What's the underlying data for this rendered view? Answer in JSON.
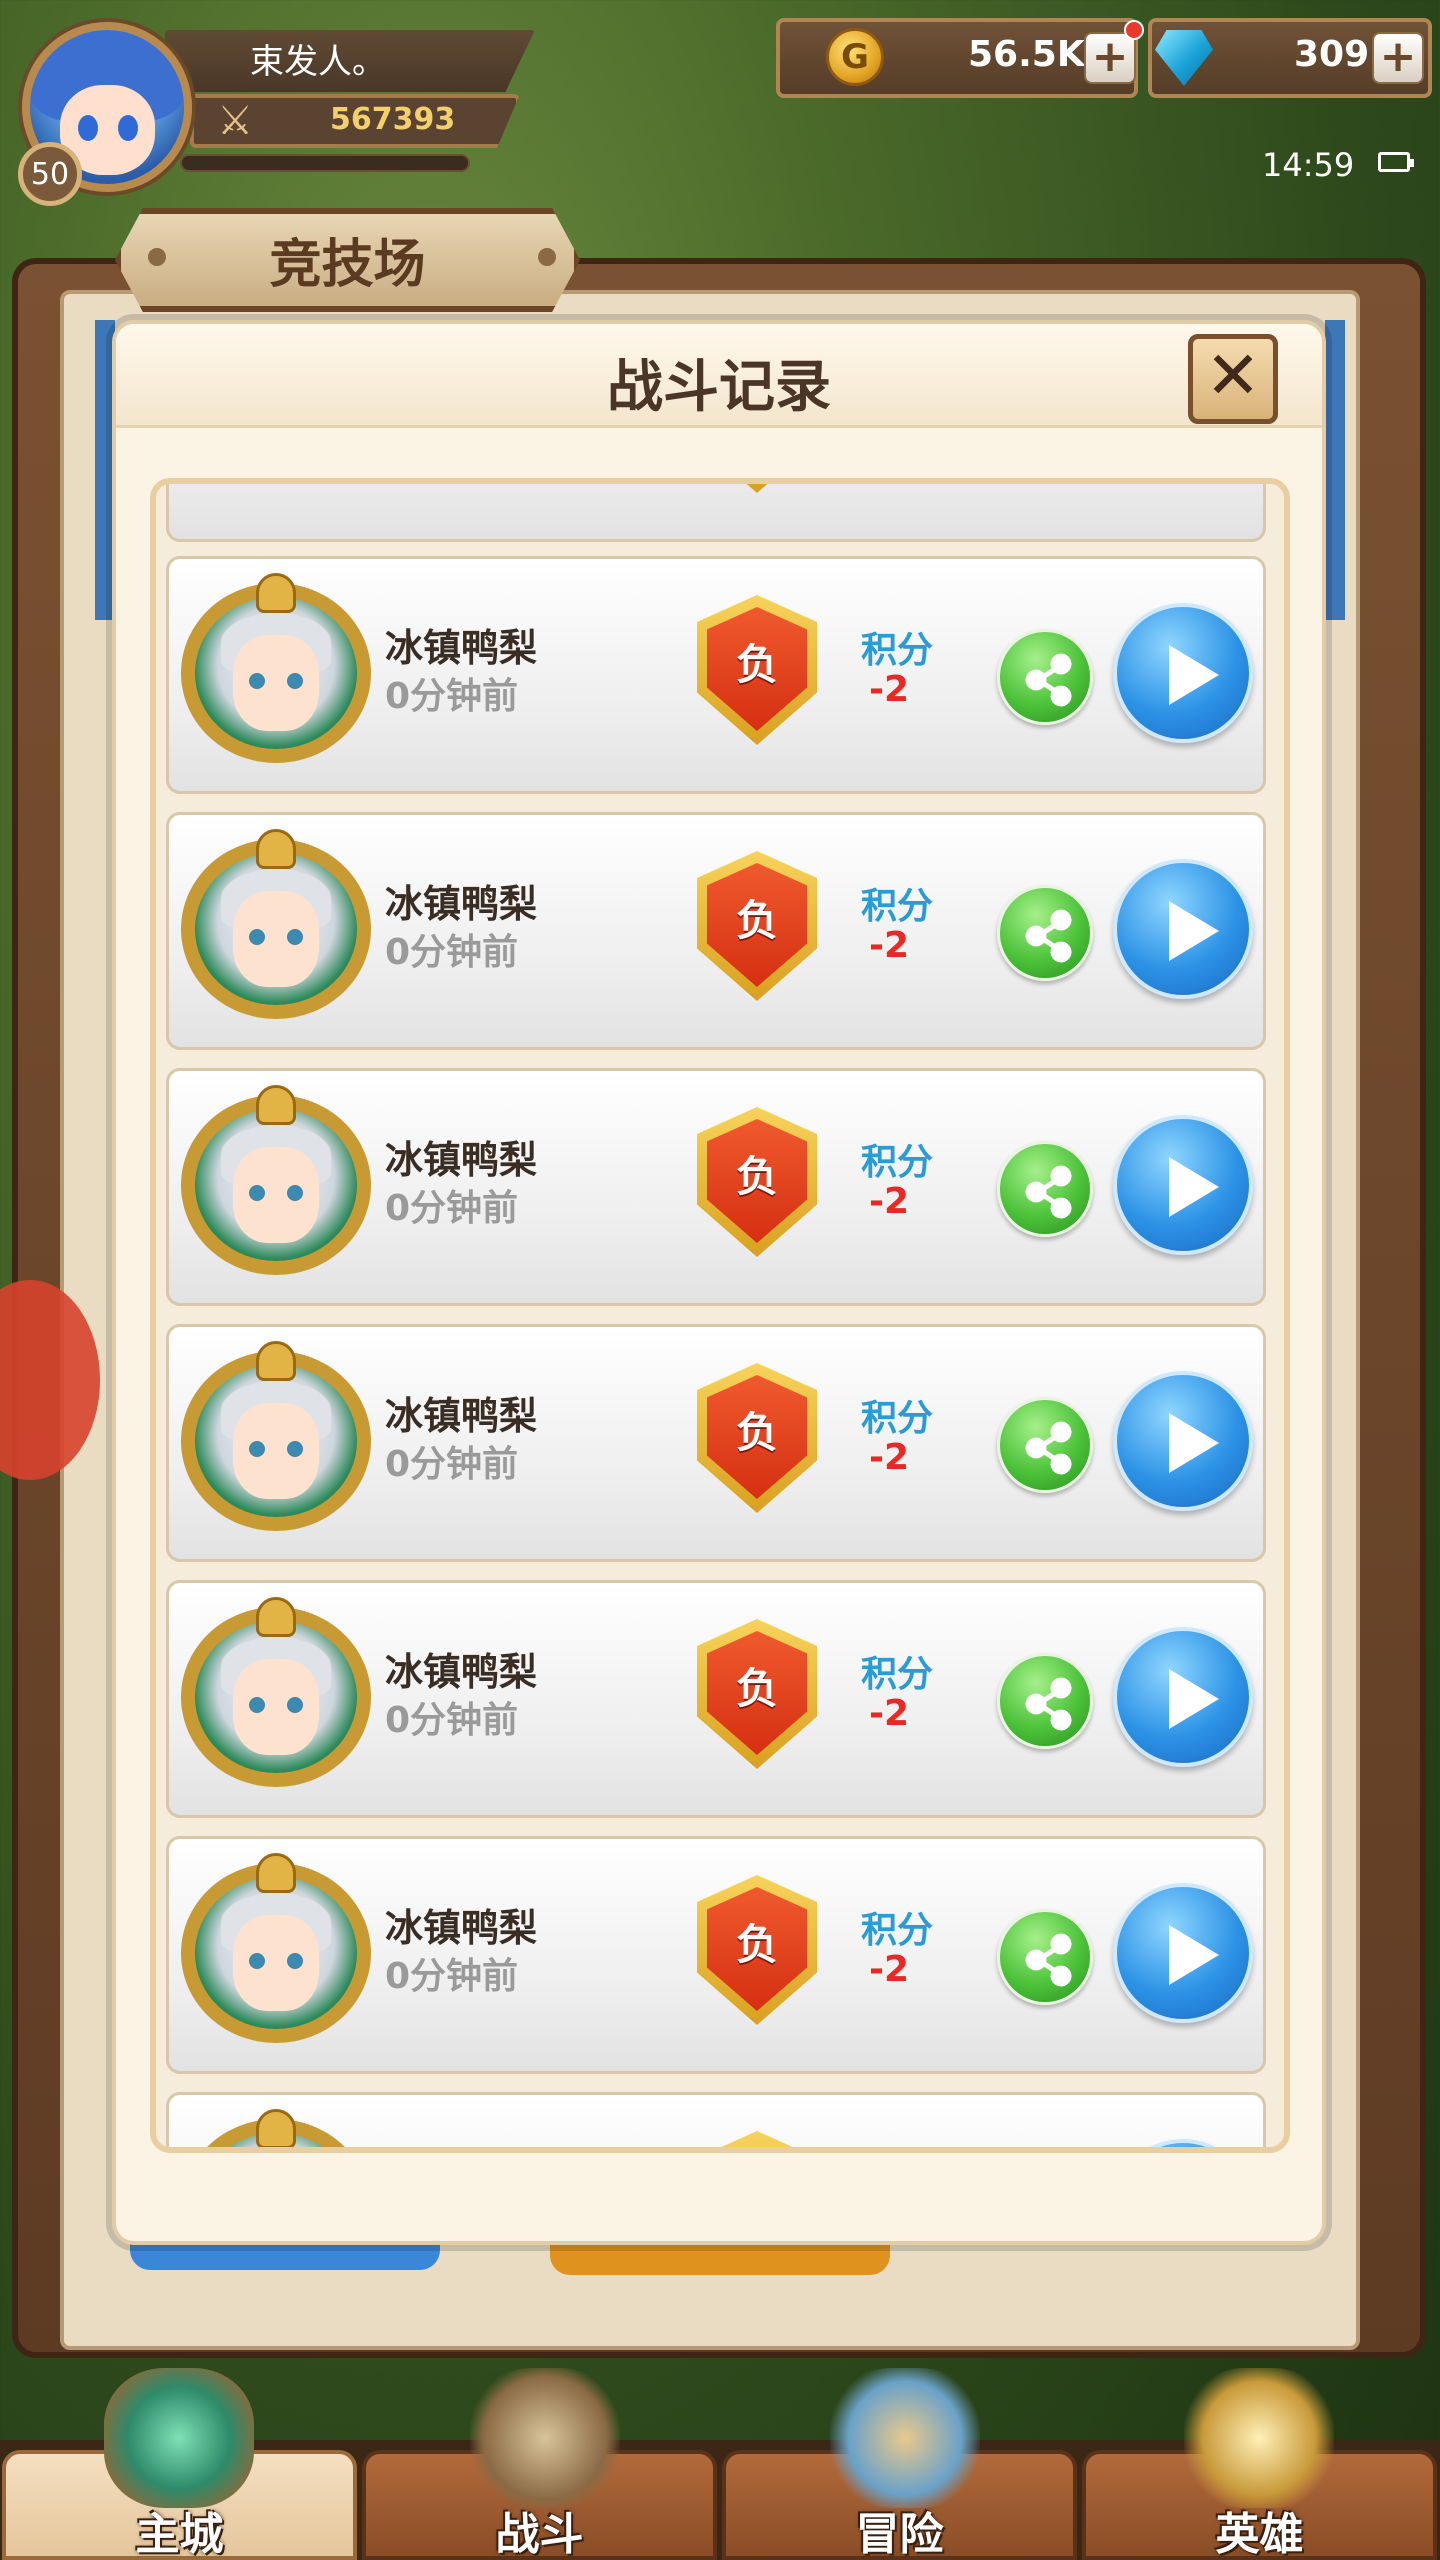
{
  "player": {
    "name": "束发人。",
    "level": "50",
    "power": "567393"
  },
  "resources": {
    "gold": "56.5K",
    "gems": "309",
    "gold_icon_glyph": "G",
    "plus_glyph": "+"
  },
  "status": {
    "time": "14:59"
  },
  "screen": {
    "title": "竞技场"
  },
  "dialog": {
    "title": "战斗记录",
    "close_glyph": "✕"
  },
  "records": [
    {
      "opponent": "冰镇鸭梨",
      "time_ago": "0分钟前",
      "result": "负",
      "score_label": "积分",
      "score": "-2"
    },
    {
      "opponent": "冰镇鸭梨",
      "time_ago": "0分钟前",
      "result": "负",
      "score_label": "积分",
      "score": "-2"
    },
    {
      "opponent": "冰镇鸭梨",
      "time_ago": "0分钟前",
      "result": "负",
      "score_label": "积分",
      "score": "-2"
    },
    {
      "opponent": "冰镇鸭梨",
      "time_ago": "0分钟前",
      "result": "负",
      "score_label": "积分",
      "score": "-2"
    },
    {
      "opponent": "冰镇鸭梨",
      "time_ago": "0分钟前",
      "result": "负",
      "score_label": "积分",
      "score": "-2"
    },
    {
      "opponent": "冰镇鸭梨",
      "time_ago": "0分钟前",
      "result": "负",
      "score_label": "积分",
      "score": "-2"
    }
  ],
  "nav": [
    {
      "label": "主城",
      "active": true
    },
    {
      "label": "战斗",
      "active": false
    },
    {
      "label": "冒险",
      "active": false
    },
    {
      "label": "英雄",
      "active": false
    }
  ],
  "colors": {
    "accent_blue": "#2a9bd8",
    "loss_red": "#e82a24",
    "gold": "#f3d06b"
  }
}
